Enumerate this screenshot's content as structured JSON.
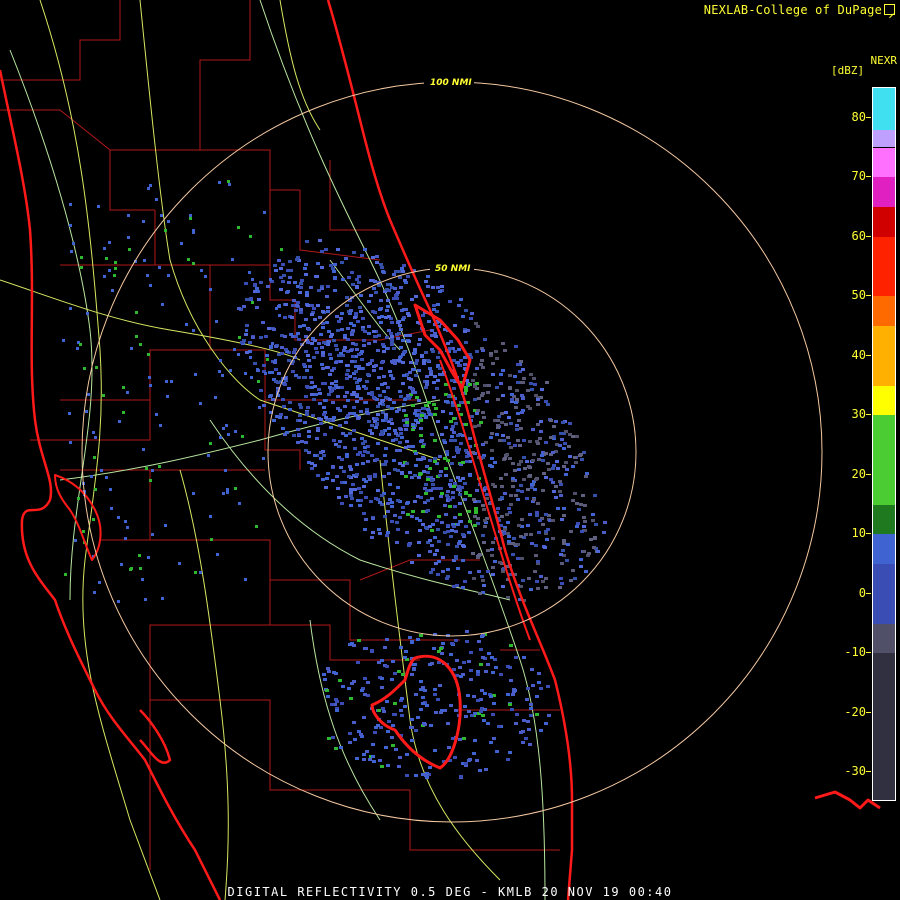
{
  "header": {
    "credit": "NEXLAB-College of DuPage",
    "credit_icon": "external-link-icon",
    "product": "NEXR",
    "units": "[dBZ]"
  },
  "footer": {
    "caption": "DIGITAL REFLECTIVITY 0.5 DEG - KMLB 20 NOV 19 00:40"
  },
  "map": {
    "range_rings": [
      {
        "label": "50 NMI",
        "range_nmi": 50
      },
      {
        "label": "100 NMI",
        "range_nmi": 100
      }
    ],
    "radar_site": "KMLB",
    "colors": {
      "coastline": "#ff1a1a",
      "county_border": "#b01818",
      "road": "#d8e860",
      "highway": "#b8e6a0",
      "range_ring": "#f4c8a0"
    }
  },
  "legend": {
    "ticks": [
      "80",
      "70",
      "60",
      "50",
      "40",
      "30",
      "20",
      "10",
      "0",
      "-10",
      "-20",
      "-30"
    ],
    "scale": [
      {
        "from": -35,
        "to": -10,
        "color": "#303040"
      },
      {
        "from": -10,
        "to": -5,
        "color": "#505068"
      },
      {
        "from": -5,
        "to": 5,
        "color": "#3a4db5"
      },
      {
        "from": 5,
        "to": 10,
        "color": "#3f63d0"
      },
      {
        "from": 10,
        "to": 15,
        "color": "#1f7a1f"
      },
      {
        "from": 15,
        "to": 30,
        "color": "#4ccc33"
      },
      {
        "from": 30,
        "to": 35,
        "color": "#ffff00"
      },
      {
        "from": 35,
        "to": 45,
        "color": "#ffb000"
      },
      {
        "from": 45,
        "to": 50,
        "color": "#ff6a00"
      },
      {
        "from": 50,
        "to": 60,
        "color": "#ff2200"
      },
      {
        "from": 60,
        "to": 65,
        "color": "#d00000"
      },
      {
        "from": 65,
        "to": 70,
        "color": "#e020c0"
      },
      {
        "from": 70,
        "to": 75,
        "color": "#ff70ff"
      },
      {
        "from": 75,
        "to": 78,
        "color": "#c0a0ff"
      },
      {
        "from": 78,
        "to": 85,
        "color": "#40e0f0"
      }
    ]
  }
}
